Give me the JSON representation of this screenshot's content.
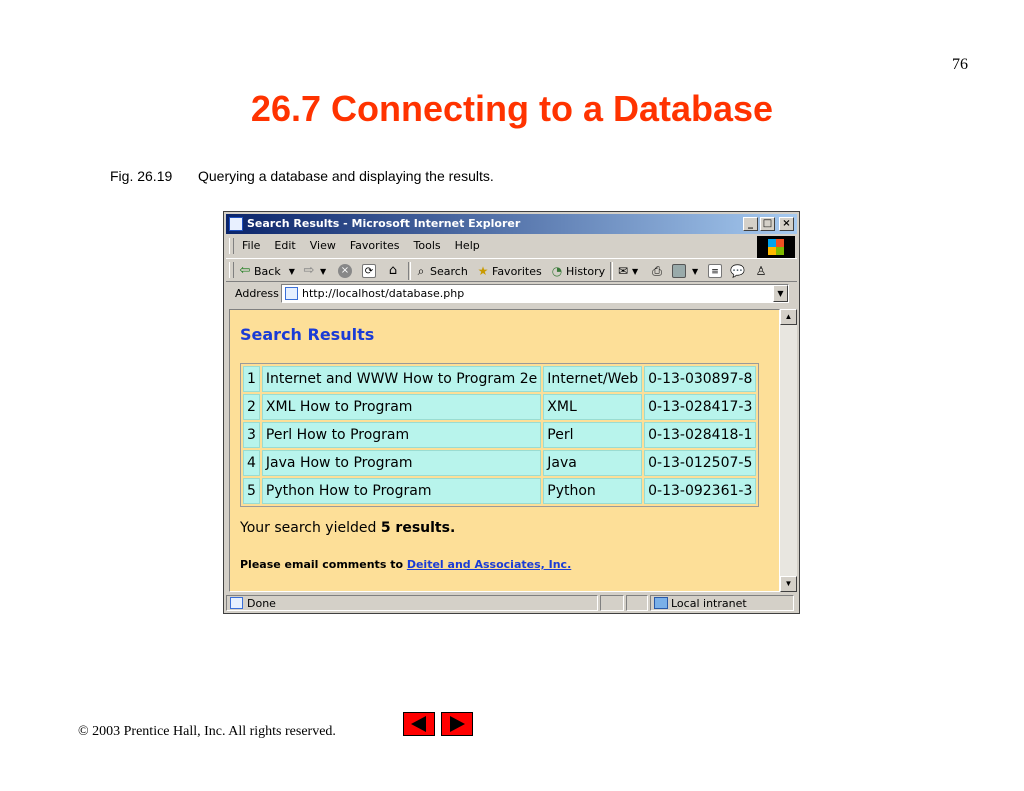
{
  "slide": {
    "number": "76",
    "title": "26.7 Connecting to a Database",
    "caption_fig": "Fig. 26.19",
    "caption_text": "Querying a database and displaying the results.",
    "copyright": "© 2003 Prentice Hall, Inc.  All rights reserved."
  },
  "browser": {
    "title": "Search Results - Microsoft Internet Explorer",
    "window_buttons": [
      "_",
      "□",
      "×"
    ],
    "menu": [
      "File",
      "Edit",
      "View",
      "Favorites",
      "Tools",
      "Help"
    ],
    "toolbar": {
      "back": "Back",
      "search": "Search",
      "favorites": "Favorites",
      "history": "History"
    },
    "address_label": "Address",
    "url": "http://localhost/database.php",
    "status_text": "Done",
    "zone_text": "Local intranet"
  },
  "page": {
    "heading": "Search Results",
    "rows": [
      {
        "id": "1",
        "title": "Internet and WWW How to Program 2e",
        "category": "Internet/Web",
        "isbn": "0-13-030897-8"
      },
      {
        "id": "2",
        "title": "XML How to Program",
        "category": "XML",
        "isbn": "0-13-028417-3"
      },
      {
        "id": "3",
        "title": "Perl How to Program",
        "category": "Perl",
        "isbn": "0-13-028418-1"
      },
      {
        "id": "4",
        "title": "Java How to Program",
        "category": "Java",
        "isbn": "0-13-012507-5"
      },
      {
        "id": "5",
        "title": "Python How to Program",
        "category": "Python",
        "isbn": "0-13-092361-3"
      }
    ],
    "summary_prefix": "Your search yielded ",
    "summary_bold": "5 results.",
    "footer_prefix": "Please email comments to ",
    "footer_link": "Deitel and Associates, Inc."
  },
  "colors": {
    "title": "#ff3300",
    "content_bg": "#fddf98",
    "cell_bg": "#b8f4ec",
    "heading_link": "#1a3cd6",
    "nav_button": "#ff0000"
  },
  "icons": {
    "back": "back-arrow-icon",
    "forward": "forward-arrow-icon",
    "stop": "stop-icon",
    "refresh": "refresh-icon",
    "home": "home-icon",
    "search": "search-icon",
    "favorites": "favorites-icon",
    "history": "history-icon",
    "mail": "mail-icon",
    "print": "print-icon",
    "edit": "edit-icon",
    "discuss": "discuss-icon",
    "messenger": "messenger-icon"
  }
}
